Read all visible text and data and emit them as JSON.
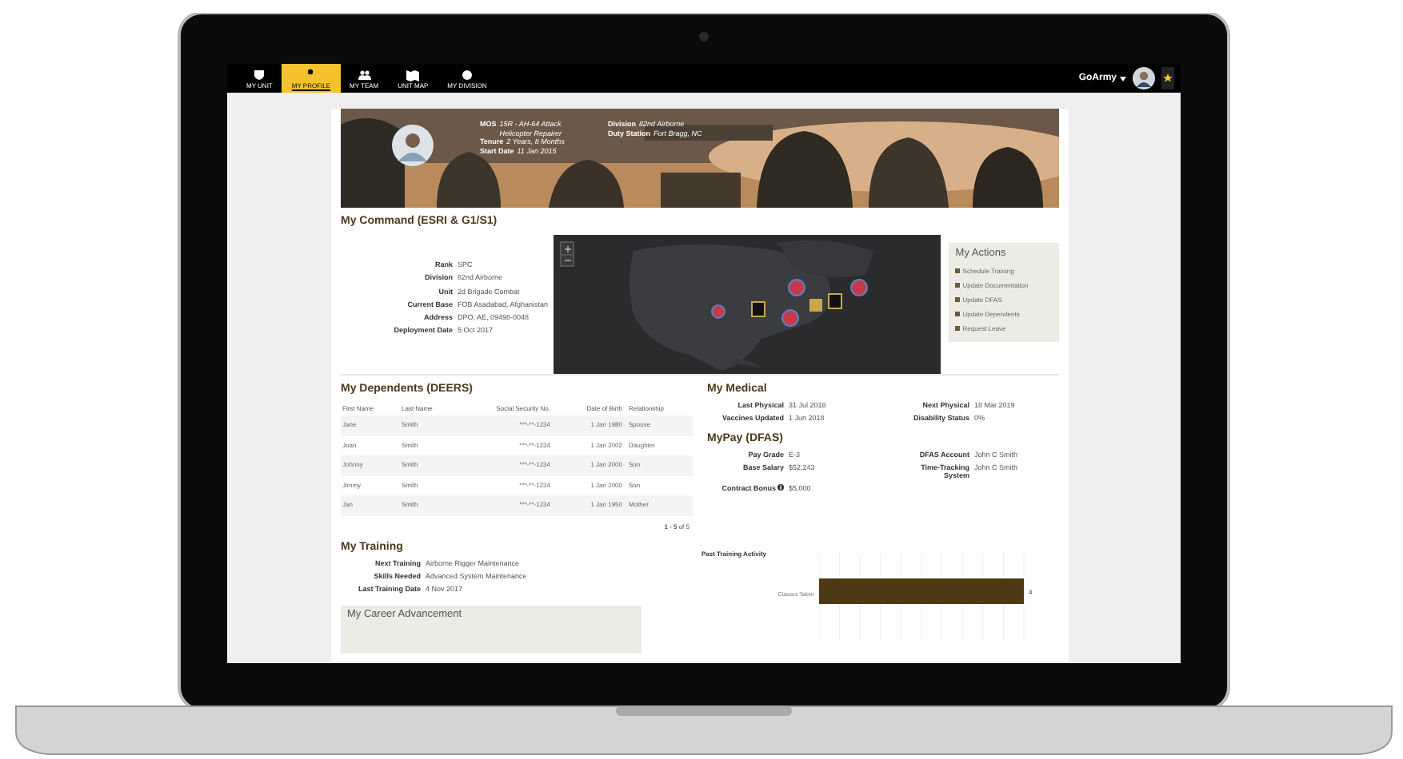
{
  "nav": {
    "items": [
      {
        "label": "MY UNIT",
        "selected": false
      },
      {
        "label": "MY PROFILE",
        "selected": true
      },
      {
        "label": "MY TEAM",
        "selected": false
      },
      {
        "label": "UNIT MAP",
        "selected": false
      },
      {
        "label": "MY DIVISION",
        "selected": false
      }
    ],
    "user": "GoArmy"
  },
  "profile": {
    "columns": [
      [
        {
          "label": "MOS",
          "value": "15R - AH-64 Attack Helicopter Repairer"
        },
        {
          "label": "Tenure",
          "value": "2 Years, 8 Months"
        },
        {
          "label": "Start Date",
          "value": "11 Jan 2015"
        }
      ],
      [
        {
          "label": "Division",
          "value": "82nd Airborne"
        },
        {
          "label": "Duty Station",
          "value": "Fort Bragg, NC"
        }
      ]
    ]
  },
  "command": {
    "title": "My Command (ESRI & G1/S1)",
    "fields": [
      {
        "label": "Rank",
        "value": "SPC"
      },
      {
        "label": "Division",
        "value": "82nd Airborne"
      },
      {
        "label": "Unit",
        "value": "2d Brigade Combat"
      },
      {
        "label": "Current Base",
        "value": "FOB Asadabad, Afghanistan"
      },
      {
        "label": "Address",
        "value": "DPO, AE, 09498-0048"
      },
      {
        "label": "Deployment Date",
        "value": "5 Oct 2017"
      }
    ]
  },
  "actions": {
    "title": "My Actions",
    "items": [
      "Schedule Training",
      "Update Documentation",
      "Update DFAS",
      "Update Dependents",
      "Request Leave"
    ]
  },
  "dependents": {
    "title": "My Dependents (DEERS)",
    "columns": [
      "First Name",
      "Last Name",
      "Social Security No.",
      "Date of Birth",
      "Relationship"
    ],
    "rows": [
      [
        "Jane",
        "Smith",
        "***-**-1234",
        "1 Jan 1980",
        "Spouse"
      ],
      [
        "Joan",
        "Smith",
        "***-**-1234",
        "1 Jan 2002",
        "Daughter"
      ],
      [
        "Johnny",
        "Smith",
        "***-**-1234",
        "1 Jan 2000",
        "Son"
      ],
      [
        "Jimmy",
        "Smith",
        "***-**-1234",
        "1 Jan 2000",
        "Son"
      ],
      [
        "Jan",
        "Smith",
        "***-**-1234",
        "1 Jan 1950",
        "Mother"
      ]
    ],
    "pagination": "**1 - 5** of 5"
  },
  "medical": {
    "title": "My Medical",
    "fields": [
      {
        "label": "Last Physical",
        "value": "31 Jul 2018"
      },
      {
        "label": "Next Physical",
        "value": "18 Mar 2019"
      },
      {
        "label": "Vaccines Updated",
        "value": "1 Jun 2018"
      },
      {
        "label": "Disability Status",
        "value": "0%"
      }
    ]
  },
  "pay": {
    "title": "MyPay (DFAS)",
    "fields": [
      {
        "label": "Pay Grade",
        "value": "E-3",
        "info": false
      },
      {
        "label": "DFAS Account",
        "value": "John C Smith",
        "info": false
      },
      {
        "label": "Base Salary",
        "value": "$52,243",
        "info": false
      },
      {
        "label": "Time-Tracking System",
        "value": "John C Smith",
        "info": false
      },
      {
        "label": "Contract Bonus",
        "value": "$5,000",
        "info": true
      }
    ]
  },
  "training": {
    "title": "My Training",
    "fields": [
      {
        "label": "Next Training",
        "value": "Airborne Rigger Maintenance"
      },
      {
        "label": "Skills Needed",
        "value": "Advanced System Maintenance"
      },
      {
        "label": "Last Training Date",
        "value": "4 Nov 2017"
      }
    ],
    "chart_data": {
      "type": "bar",
      "orientation": "horizontal",
      "title": "Past Training Activity",
      "categories": [
        "Classes Taken"
      ],
      "values": [
        4
      ],
      "data_labels": true
    }
  },
  "career": {
    "title": "My Career Advancement"
  }
}
